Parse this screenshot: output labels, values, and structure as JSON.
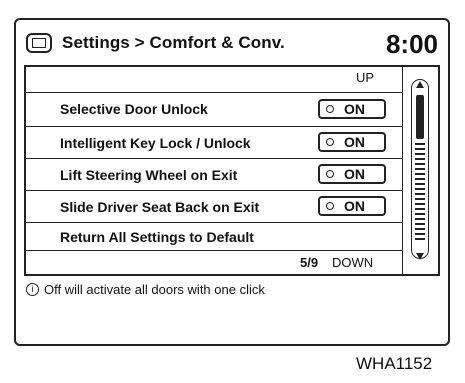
{
  "header": {
    "title": "Settings > Comfort & Conv.",
    "clock": "8:00"
  },
  "scroll": {
    "up_label": "UP",
    "down_label": "DOWN",
    "page_indicator": "5/9"
  },
  "items": [
    {
      "label": "Selective Door Unlock",
      "toggle_state": "ON"
    },
    {
      "label": "Intelligent Key Lock / Unlock",
      "toggle_state": "ON"
    },
    {
      "label": "Lift Steering Wheel on Exit",
      "toggle_state": "ON"
    },
    {
      "label": "Slide Driver Seat Back on Exit",
      "toggle_state": "ON"
    },
    {
      "label": "Return All Settings to Default"
    }
  ],
  "info": {
    "icon": "info-icon",
    "glyph": "i",
    "text": "Off will activate all doors with one click"
  },
  "figure_code": "WHA1152"
}
